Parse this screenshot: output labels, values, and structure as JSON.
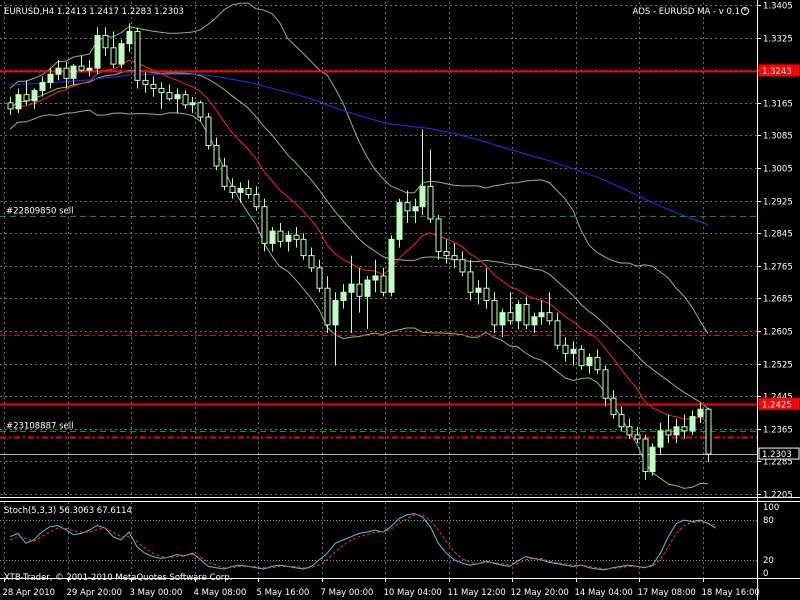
{
  "window": {
    "header": "EURUSD,H4  1.2413 1.2417 1.2283 1.2303",
    "indicator_title": "AOS - EURUSD MA - v 0.1",
    "copyright": "XTB-Trader, © 2001-2010 MetaQuotes Software Corp.",
    "stoch_label": "Stoch(5,3,3) 56.3063 67.6114"
  },
  "colors": {
    "background": "#000000",
    "grid": "#6e6e6e",
    "bull_candle": "#bfffbf",
    "bear_candle": "#000000",
    "wick": "#bfffbf",
    "bands": "#7fbf7f",
    "ma_red": "#ff2020",
    "ma_blue": "#2030ff",
    "level_red": "#ff0000",
    "order_green": "#00a000",
    "stoch_main": "#57c4e8",
    "stoch_signal": "#ff3030"
  },
  "chart_data": {
    "type": "candlestick",
    "symbol": "EURUSD",
    "timeframe": "H4",
    "ylim": [
      1.2205,
      1.3405
    ],
    "price_ticks": [
      "1.3405",
      "1.3325",
      "1.3245",
      "1.3165",
      "1.3085",
      "1.3005",
      "1.2925",
      "1.2845",
      "1.2765",
      "1.2685",
      "1.2605",
      "1.2525",
      "1.2445",
      "1.2365",
      "1.2285",
      "1.2205"
    ],
    "time_labels": [
      "28 Apr 2010",
      "29 Apr 20:00",
      "3 May 00:00",
      "4 May 08:00",
      "5 May 16:00",
      "7 May 00:00",
      "10 May 04:00",
      "11 May 12:00",
      "12 May 20:00",
      "14 May 04:00",
      "17 May 08:00",
      "18 May 16:00"
    ],
    "price_labels": [
      {
        "text": "1.3243",
        "color": "#ff0000"
      },
      {
        "text": "1.2425",
        "color": "#ff0000"
      },
      {
        "text": "1.2303",
        "color": "#000000"
      }
    ],
    "order_labels": [
      "#22809850 sell",
      "#23108887 sell"
    ],
    "stoch_ticks": [
      "100",
      "80",
      "20",
      "0"
    ],
    "candles": [
      [
        1.3165,
        1.318,
        1.3135,
        1.315
      ],
      [
        1.315,
        1.32,
        1.314,
        1.3185
      ],
      [
        1.3185,
        1.322,
        1.316,
        1.317
      ],
      [
        1.317,
        1.32,
        1.315,
        1.3195
      ],
      [
        1.3195,
        1.323,
        1.318,
        1.3215
      ],
      [
        1.3215,
        1.325,
        1.32,
        1.3235
      ],
      [
        1.3235,
        1.327,
        1.322,
        1.325
      ],
      [
        1.325,
        1.3265,
        1.32,
        1.3225
      ],
      [
        1.3225,
        1.326,
        1.321,
        1.3255
      ],
      [
        1.3255,
        1.328,
        1.324,
        1.3245
      ],
      [
        1.3245,
        1.327,
        1.323,
        1.325
      ],
      [
        1.325,
        1.335,
        1.3235,
        1.333
      ],
      [
        1.333,
        1.335,
        1.328,
        1.33
      ],
      [
        1.33,
        1.334,
        1.325,
        1.326
      ],
      [
        1.326,
        1.332,
        1.325,
        1.331
      ],
      [
        1.331,
        1.336,
        1.329,
        1.334
      ],
      [
        1.334,
        1.335,
        1.32,
        1.322
      ],
      [
        1.322,
        1.324,
        1.319,
        1.321
      ],
      [
        1.321,
        1.323,
        1.318,
        1.32
      ],
      [
        1.32,
        1.3215,
        1.315,
        1.319
      ],
      [
        1.319,
        1.321,
        1.317,
        1.3175
      ],
      [
        1.3175,
        1.32,
        1.314,
        1.3185
      ],
      [
        1.3185,
        1.3195,
        1.315,
        1.316
      ],
      [
        1.316,
        1.318,
        1.314,
        1.3165
      ],
      [
        1.3165,
        1.317,
        1.312,
        1.313
      ],
      [
        1.313,
        1.314,
        1.305,
        1.306
      ],
      [
        1.306,
        1.308,
        1.3,
        1.301
      ],
      [
        1.301,
        1.303,
        1.295,
        1.296
      ],
      [
        1.296,
        1.298,
        1.293,
        1.2945
      ],
      [
        1.2945,
        1.297,
        1.292,
        1.2955
      ],
      [
        1.2955,
        1.2975,
        1.293,
        1.294
      ],
      [
        1.294,
        1.296,
        1.29,
        1.291
      ],
      [
        1.291,
        1.293,
        1.28,
        1.282
      ],
      [
        1.282,
        1.286,
        1.28,
        1.285
      ],
      [
        1.285,
        1.287,
        1.281,
        1.2825
      ],
      [
        1.2825,
        1.285,
        1.28,
        1.284
      ],
      [
        1.284,
        1.286,
        1.281,
        1.283
      ],
      [
        1.283,
        1.2845,
        1.278,
        1.279
      ],
      [
        1.279,
        1.281,
        1.275,
        1.276
      ],
      [
        1.276,
        1.278,
        1.27,
        1.271
      ],
      [
        1.271,
        1.274,
        1.26,
        1.262
      ],
      [
        1.262,
        1.27,
        1.252,
        1.268
      ],
      [
        1.268,
        1.272,
        1.266,
        1.27
      ],
      [
        1.27,
        1.279,
        1.26,
        1.272
      ],
      [
        1.272,
        1.276,
        1.265,
        1.269
      ],
      [
        1.269,
        1.274,
        1.261,
        1.273
      ],
      [
        1.273,
        1.278,
        1.27,
        1.274
      ],
      [
        1.274,
        1.276,
        1.269,
        1.27
      ],
      [
        1.27,
        1.284,
        1.269,
        1.283
      ],
      [
        1.283,
        1.293,
        1.281,
        1.292
      ],
      [
        1.292,
        1.295,
        1.287,
        1.29
      ],
      [
        1.29,
        1.293,
        1.287,
        1.291
      ],
      [
        1.291,
        1.31,
        1.289,
        1.296
      ],
      [
        1.296,
        1.305,
        1.287,
        1.288
      ],
      [
        1.288,
        1.289,
        1.278,
        1.28
      ],
      [
        1.28,
        1.283,
        1.277,
        1.279
      ],
      [
        1.279,
        1.282,
        1.276,
        1.278
      ],
      [
        1.278,
        1.28,
        1.274,
        1.275
      ],
      [
        1.275,
        1.278,
        1.268,
        1.27
      ],
      [
        1.27,
        1.273,
        1.267,
        1.271
      ],
      [
        1.271,
        1.276,
        1.266,
        1.268
      ],
      [
        1.268,
        1.27,
        1.26,
        1.262
      ],
      [
        1.262,
        1.266,
        1.259,
        1.265
      ],
      [
        1.265,
        1.27,
        1.262,
        1.263
      ],
      [
        1.263,
        1.268,
        1.261,
        1.267
      ],
      [
        1.267,
        1.269,
        1.261,
        1.262
      ],
      [
        1.262,
        1.265,
        1.26,
        1.264
      ],
      [
        1.264,
        1.268,
        1.262,
        1.265
      ],
      [
        1.265,
        1.27,
        1.262,
        1.263
      ],
      [
        1.263,
        1.265,
        1.256,
        1.257
      ],
      [
        1.257,
        1.259,
        1.253,
        1.255
      ],
      [
        1.255,
        1.258,
        1.252,
        1.256
      ],
      [
        1.256,
        1.257,
        1.251,
        1.252
      ],
      [
        1.252,
        1.255,
        1.25,
        1.254
      ],
      [
        1.254,
        1.256,
        1.25,
        1.251
      ],
      [
        1.251,
        1.252,
        1.242,
        1.244
      ],
      [
        1.244,
        1.246,
        1.239,
        1.24
      ],
      [
        1.24,
        1.242,
        1.236,
        1.237
      ],
      [
        1.237,
        1.239,
        1.234,
        1.235
      ],
      [
        1.235,
        1.237,
        1.233,
        1.234
      ],
      [
        1.234,
        1.235,
        1.224,
        1.226
      ],
      [
        1.226,
        1.233,
        1.225,
        1.232
      ],
      [
        1.232,
        1.238,
        1.23,
        1.236
      ],
      [
        1.236,
        1.24,
        1.233,
        1.235
      ],
      [
        1.235,
        1.239,
        1.233,
        1.237
      ],
      [
        1.237,
        1.24,
        1.234,
        1.236
      ],
      [
        1.236,
        1.241,
        1.235,
        1.2395
      ],
      [
        1.2395,
        1.243,
        1.238,
        1.2413
      ],
      [
        1.2413,
        1.2417,
        1.2283,
        1.2303
      ]
    ],
    "stochastic": {
      "main": [
        55,
        60,
        45,
        50,
        62,
        70,
        72,
        66,
        58,
        60,
        65,
        72,
        68,
        55,
        50,
        62,
        40,
        30,
        25,
        22,
        24,
        28,
        26,
        30,
        20,
        10,
        8,
        6,
        10,
        12,
        10,
        8,
        6,
        10,
        12,
        10,
        8,
        6,
        10,
        20,
        30,
        45,
        50,
        55,
        60,
        62,
        65,
        62,
        70,
        82,
        88,
        90,
        85,
        70,
        45,
        30,
        20,
        15,
        12,
        14,
        18,
        15,
        12,
        10,
        18,
        25,
        22,
        20,
        16,
        14,
        12,
        10,
        12,
        8,
        6,
        5,
        8,
        10,
        12,
        10,
        8,
        12,
        30,
        55,
        75,
        80,
        78,
        80,
        75,
        68
      ],
      "signal": [
        50,
        55,
        52,
        48,
        55,
        62,
        68,
        68,
        64,
        62,
        62,
        66,
        68,
        62,
        55,
        55,
        48,
        38,
        30,
        25,
        23,
        25,
        26,
        28,
        24,
        16,
        12,
        8,
        8,
        10,
        10,
        10,
        8,
        8,
        10,
        10,
        10,
        8,
        8,
        12,
        20,
        32,
        42,
        50,
        55,
        58,
        62,
        62,
        66,
        75,
        82,
        88,
        88,
        80,
        65,
        48,
        32,
        22,
        16,
        14,
        16,
        16,
        14,
        12,
        14,
        20,
        22,
        22,
        18,
        16,
        14,
        12,
        12,
        10,
        8,
        6,
        7,
        8,
        10,
        10,
        9,
        10,
        20,
        40,
        60,
        72,
        76,
        78,
        76,
        72
      ]
    }
  }
}
